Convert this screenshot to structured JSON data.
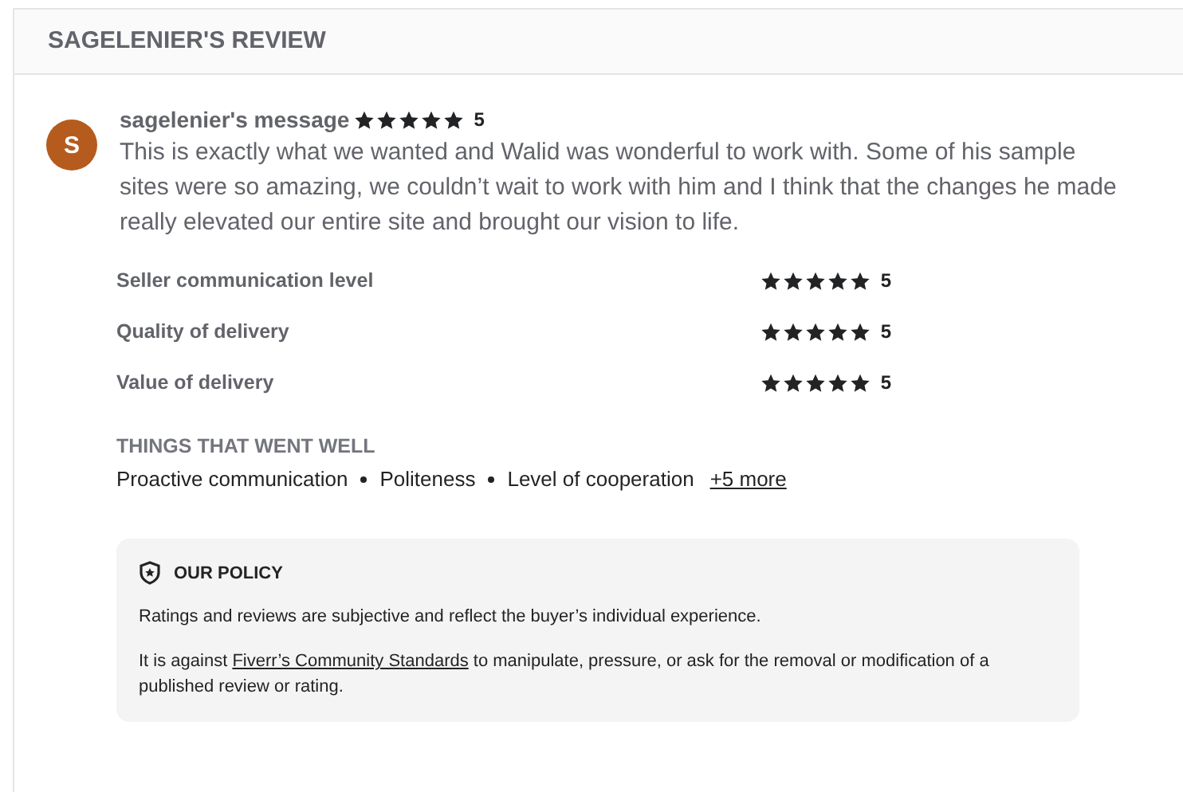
{
  "header": {
    "title": "SAGELENIER'S REVIEW"
  },
  "message": {
    "avatar": "S",
    "author": "sagelenier's message",
    "stars": 5,
    "rating": "5",
    "text": "This is exactly what we wanted and Walid was wonderful to work with. Some of his sample sites were so amazing, we couldn’t wait to work with him and I think that the changes he made really elevated our entire site and brought our vision to life."
  },
  "ratings": [
    {
      "label": "Seller communication level",
      "stars": 5,
      "rating": "5"
    },
    {
      "label": "Quality of delivery",
      "stars": 5,
      "rating": "5"
    },
    {
      "label": "Value of delivery",
      "stars": 5,
      "rating": "5"
    }
  ],
  "went_well": {
    "title": "THINGS THAT WENT WELL",
    "items": [
      "Proactive communication",
      "Politeness",
      "Level of cooperation"
    ],
    "more": "+5 more"
  },
  "policy": {
    "title": "OUR POLICY",
    "paragraph_1": "Ratings and reviews are subjective and reflect the buyer’s individual experience.",
    "paragraph_2": {
      "before": "It is against ",
      "link": "Fiverr’s Community Standards",
      "after": " to manipulate, pressure, or ask for the removal or modification of a published review or rating."
    }
  }
}
